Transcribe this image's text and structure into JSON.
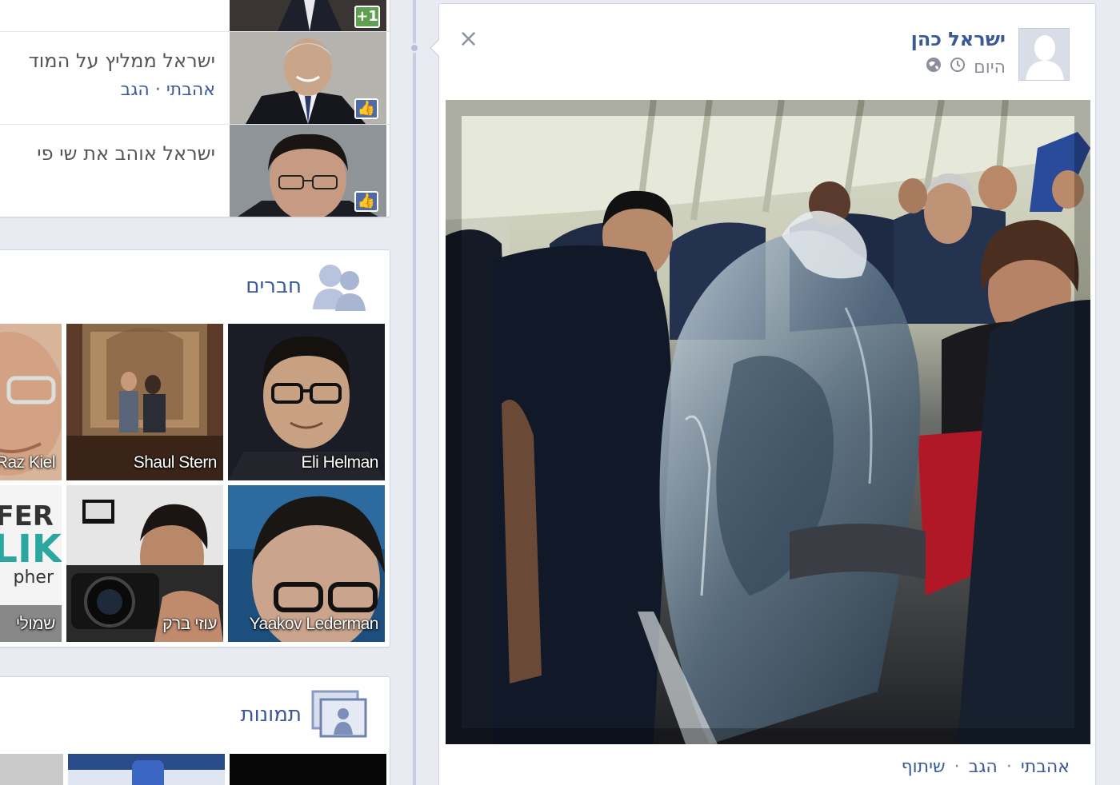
{
  "activity": {
    "rows": [
      {
        "text": "",
        "sub": "",
        "badge": "+1"
      },
      {
        "text": "ישראל ממליץ על המוד",
        "like_label": "אהבתי",
        "dot": "·",
        "reply_label": "הגב"
      },
      {
        "text": "ישראל אוהב את שי פי"
      }
    ]
  },
  "friends": {
    "title": "חברים",
    "tiles": [
      {
        "name": "Eli Helman"
      },
      {
        "name": "Shaul Stern"
      },
      {
        "name": "Raz Kiel"
      },
      {
        "name": "Yaakov Lederman"
      },
      {
        "name": "עוזי ברק"
      },
      {
        "name": "שמולי"
      }
    ],
    "logo_text_top": "FER",
    "logo_text_mid": "LIK",
    "logo_text_bottom": "pher"
  },
  "photos": {
    "title": "תמונות"
  },
  "post": {
    "author": "ישראל כהן",
    "time": "היום",
    "close_icon": "×",
    "actions": {
      "like": "אהבתי",
      "comment": "הגב",
      "share": "שיתוף",
      "dot": "·"
    }
  },
  "colors": {
    "link": "#3b5998",
    "background": "#e9ebf2",
    "border": "#cfd5e3"
  }
}
